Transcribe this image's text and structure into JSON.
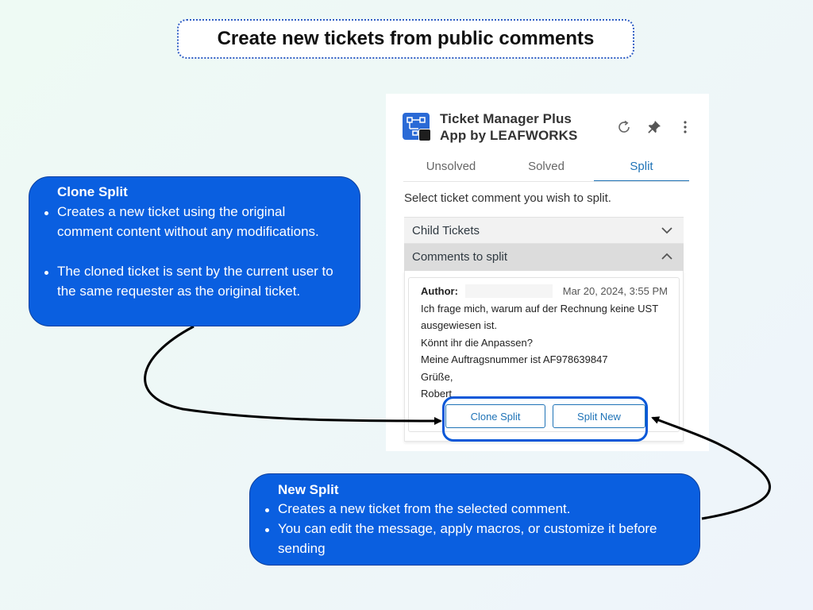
{
  "banner": {
    "title": "Create new tickets from public comments"
  },
  "app": {
    "title_line1": "Ticket Manager Plus",
    "title_line2": "App by LEAFWORKS",
    "icons": [
      "refresh-icon",
      "pin-icon",
      "more-vertical-icon"
    ]
  },
  "tabs": [
    {
      "label": "Unsolved",
      "active": false
    },
    {
      "label": "Solved",
      "active": false
    },
    {
      "label": "Split",
      "active": true
    }
  ],
  "instruction": "Select ticket comment you wish to split.",
  "accordion": {
    "child_tickets": "Child Tickets",
    "comments_to_split": "Comments to split"
  },
  "comment": {
    "author_label": "Author:",
    "author_name": "",
    "date": "Mar 20, 2024, 3:55 PM",
    "lines": [
      "Ich frage mich, warum auf der Rechnung keine UST",
      "ausgewiesen ist.",
      "Könnt ihr die Anpassen?",
      "Meine Auftragsnummer ist AF978639847",
      "Grüße,",
      "Robert"
    ]
  },
  "buttons": {
    "clone_split": "Clone Split",
    "split_new": "Split New"
  },
  "callouts": {
    "clone": {
      "heading": "Clone Split",
      "bullets": [
        [
          "Creates a new ticket using the original",
          "comment content without any modifications."
        ],
        [
          "The cloned ticket is sent by the current user to",
          "the same requester as the original ticket."
        ]
      ]
    },
    "new": {
      "heading": "New Split",
      "bullets": [
        [
          "Creates a new ticket from the selected comment."
        ],
        [
          "You can edit the message, apply macros, or customize it before",
          "sending"
        ]
      ]
    }
  },
  "colors": {
    "accent": "#1f73b7",
    "callout": "#0a5fe0",
    "highlight": "#0a58d8"
  }
}
